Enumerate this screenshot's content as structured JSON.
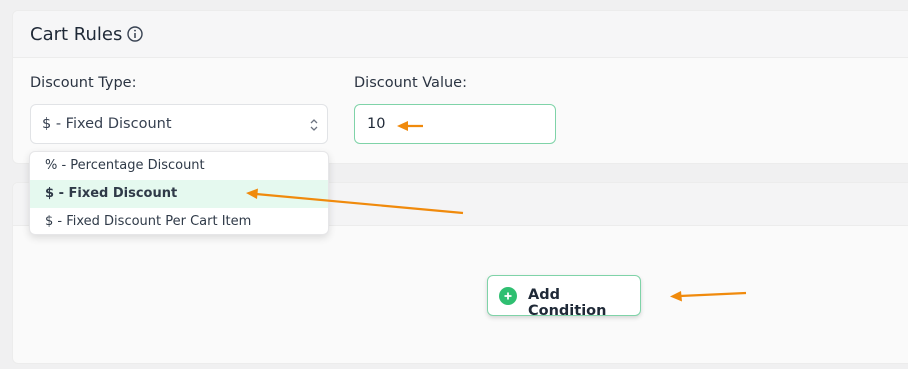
{
  "cart_rules": {
    "title": "Cart Rules",
    "info_icon": "info-icon"
  },
  "discount_type": {
    "label": "Discount Type:",
    "selected": "$ - Fixed Discount",
    "options": [
      "% - Percentage Discount",
      "$ - Fixed Discount",
      "$ - Fixed Discount Per Cart Item"
    ],
    "highlighted_index": 1
  },
  "discount_value": {
    "label": "Discount Value:",
    "value": "10"
  },
  "add_condition": {
    "label": "Add Condition",
    "icon": "plus-circle-icon"
  },
  "colors": {
    "accent": "#2fbf71",
    "annotation_arrow": "#f08a0c",
    "highlight": "#e5f9ef"
  }
}
